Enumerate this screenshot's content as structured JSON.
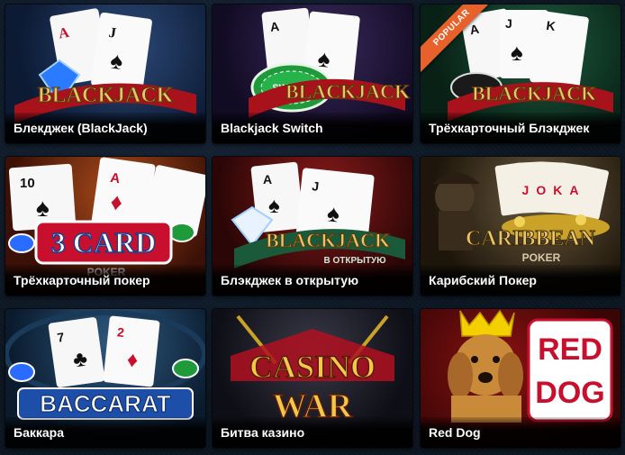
{
  "games": [
    {
      "label": "Блекджек (BlackJack)",
      "logo": "BLACKJACK"
    },
    {
      "label": "Blackjack Switch",
      "logo": "BLACKJACK",
      "chip_text": "SWITCH"
    },
    {
      "label": "Трёхкарточный Блэкджек",
      "logo": "BLACKJACK",
      "badge": "POPULAR"
    },
    {
      "label": "Трёхкарточный покер",
      "logo": "3 CARD",
      "logo_sub": "POKER"
    },
    {
      "label": "Блэкджек в открытую",
      "logo": "BLACKJACK",
      "logo_sub": "В ОТКРЫТУЮ"
    },
    {
      "label": "Карибский Покер",
      "logo": "CARIBBEAN",
      "logo_sub": "POKER",
      "cards_text": "JOKA"
    },
    {
      "label": "Баккара",
      "logo": "BACCARAT"
    },
    {
      "label": "Битва казино",
      "logo": "CASINO",
      "logo_sub": "WAR"
    },
    {
      "label": "Red Dog",
      "logo": "RED",
      "logo_sub": "DOG"
    }
  ],
  "colors": {
    "background": "#0c1622",
    "badge": "#e8602a",
    "caption_text": "#ffffff"
  }
}
